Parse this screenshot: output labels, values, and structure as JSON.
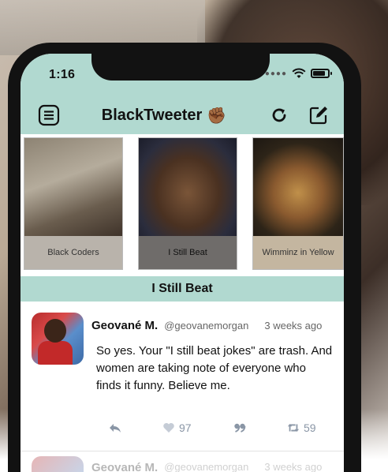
{
  "status": {
    "time": "1:16"
  },
  "navbar": {
    "title": "BlackTweeter",
    "title_emoji": "✊🏾"
  },
  "cards": [
    {
      "caption": "Black Coders"
    },
    {
      "caption": "I Still Beat"
    },
    {
      "caption": "Wimminz in Yellow"
    }
  ],
  "section": {
    "title": "I Still Beat"
  },
  "tweets": [
    {
      "name": "Geované M.",
      "handle": "@geovanemorgan",
      "time": "3 weeks ago",
      "text": "So yes. Your \"I still beat jokes\" are trash. And women are taking note of everyone who finds it funny. Believe me.",
      "likes": "97",
      "retweets": "59"
    },
    {
      "name": "Geované M.",
      "handle": "@geovanemorgan",
      "time": "3 weeks ago"
    }
  ],
  "colors": {
    "accent": "#b1d9d0",
    "action_gray": "#8a96a6"
  },
  "icons": [
    "menu-icon",
    "refresh-icon",
    "compose-icon",
    "reply-icon",
    "heart-icon",
    "quote-icon",
    "retweet-icon",
    "wifi-icon",
    "battery-icon"
  ]
}
